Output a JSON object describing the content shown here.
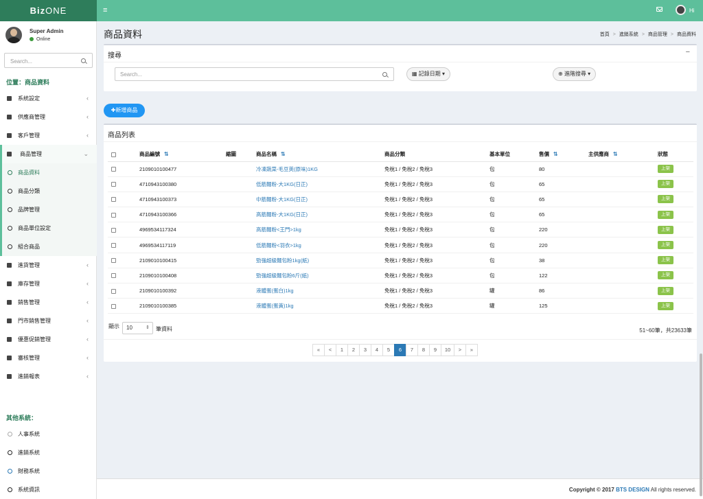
{
  "app": {
    "logo_bold": "Biz",
    "logo_light": "ONE",
    "menu_toggle": "≡",
    "user_greeting": "Hi"
  },
  "user": {
    "name": "Super Admin",
    "status": "Online"
  },
  "sidebar": {
    "search_placeholder": "Search...",
    "location": "位置：商品資料",
    "menu": [
      {
        "label": "系統設定"
      },
      {
        "label": "供應商管理"
      },
      {
        "label": "客戶管理"
      },
      {
        "label": "商品管理"
      }
    ],
    "submenu": [
      {
        "label": "商品資料"
      },
      {
        "label": "商品分類"
      },
      {
        "label": "品牌管理"
      },
      {
        "label": "商品單位設定"
      },
      {
        "label": "組合商品"
      }
    ],
    "menu2": [
      {
        "label": "進貨管理"
      },
      {
        "label": "庫存管理"
      },
      {
        "label": "銷售管理"
      },
      {
        "label": "門市銷售管理"
      },
      {
        "label": "優惠促銷管理"
      },
      {
        "label": "審核管理"
      },
      {
        "label": "進銷報表"
      }
    ],
    "other_title": "其他系統：",
    "other": [
      {
        "label": "人事系統"
      },
      {
        "label": "進銷系統"
      },
      {
        "label": "財務系統"
      },
      {
        "label": "系統資訊"
      }
    ]
  },
  "page": {
    "title": "商品資料",
    "breadcrumb": [
      "首頁",
      "進銷系統",
      "商品管理",
      "商品資料"
    ]
  },
  "search_box": {
    "title": "搜尋",
    "collapse": "−",
    "placeholder": "Search...",
    "date_button": "記錄日期",
    "advanced_button": "進階搜尋"
  },
  "add_button": "✚新增商品",
  "list": {
    "title": "商品列表",
    "headers": [
      "商品編號",
      "縮圖",
      "商品名稱",
      "商品分類",
      "基本單位",
      "售價",
      "主供應商",
      "狀態"
    ],
    "rows": [
      {
        "code": "2109010100477",
        "name": "冷凍蔬菜-毛豆莢(原味)1KG",
        "category": "免稅1 / 免稅2 / 免稅3",
        "unit": "包",
        "price": "80",
        "status": "上架"
      },
      {
        "code": "4710943100380",
        "name": "低筋麵粉-大1KG(日正)",
        "category": "免稅1 / 免稅2 / 免稅3",
        "unit": "包",
        "price": "65",
        "status": "上架"
      },
      {
        "code": "4710943100373",
        "name": "中筋麵粉-大1KG(日正)",
        "category": "免稅1 / 免稅2 / 免稅3",
        "unit": "包",
        "price": "65",
        "status": "上架"
      },
      {
        "code": "4710943100366",
        "name": "高筋麵粉-大1KG(日正)",
        "category": "免稅1 / 免稅2 / 免稅3",
        "unit": "包",
        "price": "65",
        "status": "上架"
      },
      {
        "code": "4969534117324",
        "name": "高筋麵粉<王門>1kg",
        "category": "免稅1 / 免稅2 / 免稅3",
        "unit": "包",
        "price": "220",
        "status": "上架"
      },
      {
        "code": "4969534117119",
        "name": "低筋麵粉<羽衣>1kg",
        "category": "免稅1 / 免稅2 / 免稅3",
        "unit": "包",
        "price": "220",
        "status": "上架"
      },
      {
        "code": "2109010100415",
        "name": "勁強超級麵包粉1kg(紙)",
        "category": "免稅1 / 免稅2 / 免稅3",
        "unit": "包",
        "price": "38",
        "status": "上架"
      },
      {
        "code": "2109010100408",
        "name": "勁強超級麵包粉6斤(紙)",
        "category": "免稅1 / 免稅2 / 免稅3",
        "unit": "包",
        "price": "122",
        "status": "上架"
      },
      {
        "code": "2109010100392",
        "name": "液體蛋(蛋白)1kg",
        "category": "免稅1 / 免稅2 / 免稅3",
        "unit": "罐",
        "price": "86",
        "status": "上架"
      },
      {
        "code": "2109010100385",
        "name": "液體蛋(蛋黃)1kg",
        "category": "免稅1 / 免稅2 / 免稅3",
        "unit": "罐",
        "price": "125",
        "status": "上架"
      }
    ],
    "show_label": "顯示",
    "page_size": "10",
    "show_suffix": "筆資料",
    "total": "51~60筆，共23633筆",
    "pages": [
      "«",
      "<",
      "1",
      "2",
      "3",
      "4",
      "5",
      "6",
      "7",
      "8",
      "9",
      "10",
      ">",
      "»"
    ],
    "current_page": "6"
  },
  "footer": {
    "prefix": "Copyright © 2017 ",
    "brand": "BTS DESIGN",
    "suffix": " All rights reserved."
  },
  "colors": {
    "accent": "#5dbf9b",
    "logo_bg": "#2e7d5b",
    "link": "#2b79b5",
    "primary_button": "#2196f3",
    "badge": "#8bc34a"
  }
}
